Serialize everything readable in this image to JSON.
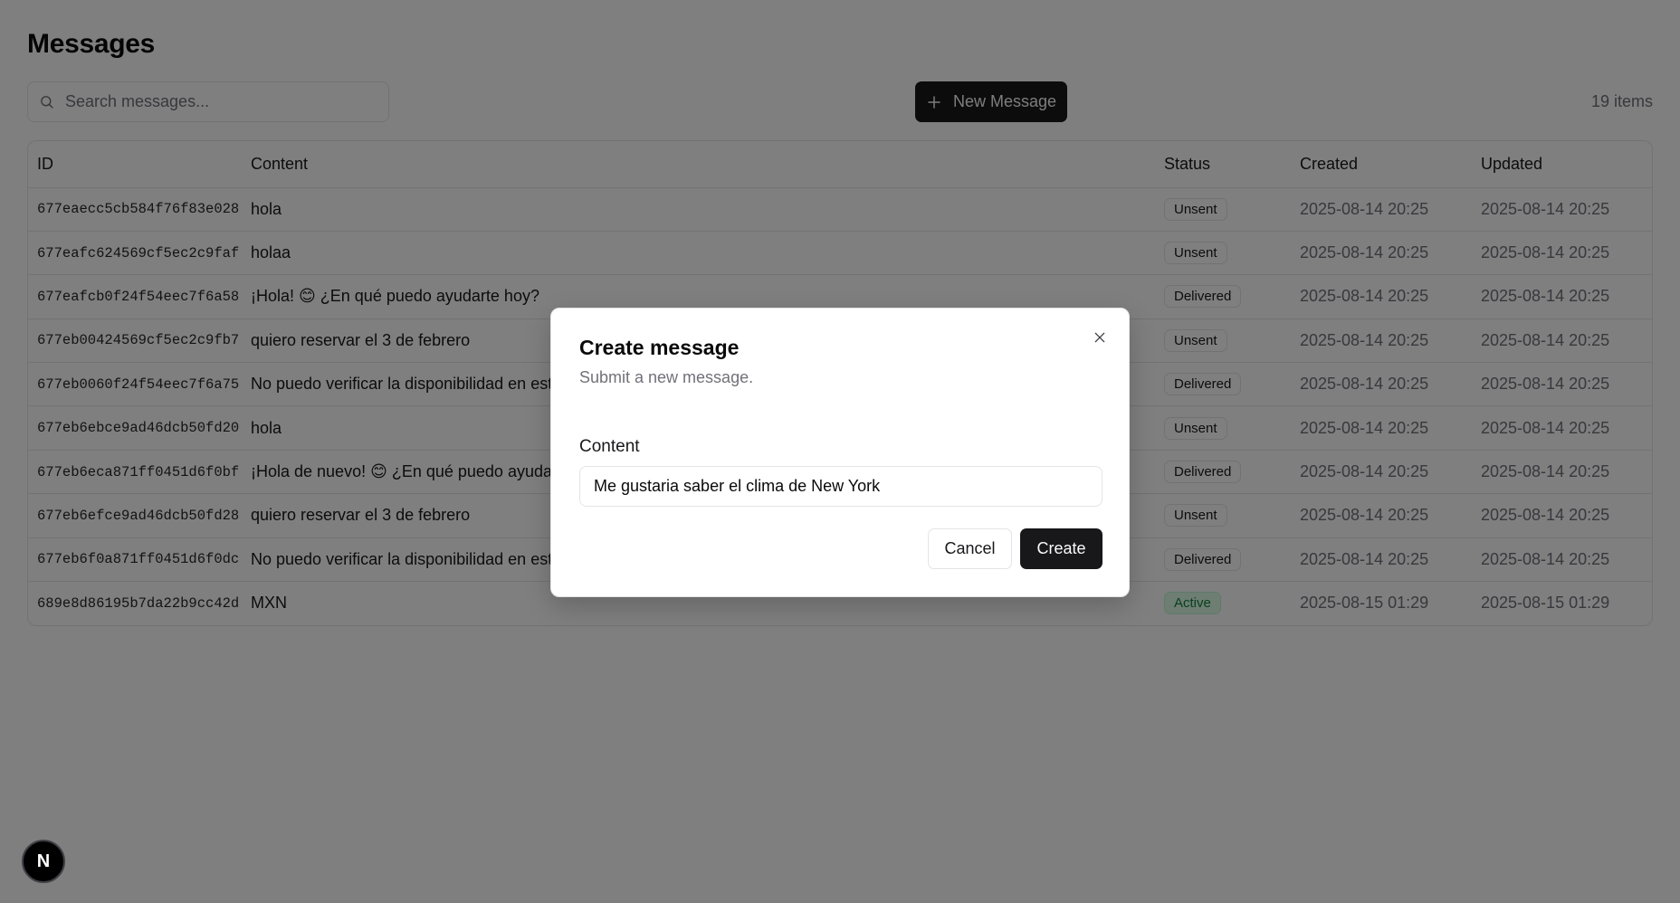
{
  "page": {
    "title": "Messages"
  },
  "toolbar": {
    "search_placeholder": "Search messages...",
    "new_button_label": "New Message",
    "item_count": "19 items"
  },
  "table": {
    "headers": [
      "ID",
      "Content",
      "Status",
      "Created",
      "Updated"
    ],
    "rows": [
      {
        "id": "677eaecc5cb584f76f83e028",
        "content": "hola",
        "status": "Unsent",
        "created": "2025-08-14 20:25",
        "updated": "2025-08-14 20:25"
      },
      {
        "id": "677eafc624569cf5ec2c9faf",
        "content": "holaa",
        "status": "Unsent",
        "created": "2025-08-14 20:25",
        "updated": "2025-08-14 20:25"
      },
      {
        "id": "677eafcb0f24f54eec7f6a58",
        "content": "¡Hola! 😊 ¿En qué puedo ayudarte hoy?",
        "status": "Delivered",
        "created": "2025-08-14 20:25",
        "updated": "2025-08-14 20:25"
      },
      {
        "id": "677eb00424569cf5ec2c9fb7",
        "content": "quiero reservar el 3 de febrero",
        "status": "Unsent",
        "created": "2025-08-14 20:25",
        "updated": "2025-08-14 20:25"
      },
      {
        "id": "677eb0060f24f54eec7f6a75",
        "content": "No puedo verificar la disponibilidad en este",
        "status": "Delivered",
        "created": "2025-08-14 20:25",
        "updated": "2025-08-14 20:25"
      },
      {
        "id": "677eb6ebce9ad46dcb50fd20",
        "content": "hola",
        "status": "Unsent",
        "created": "2025-08-14 20:25",
        "updated": "2025-08-14 20:25"
      },
      {
        "id": "677eb6eca871ff0451d6f0bf",
        "content": "¡Hola de nuevo! 😊 ¿En qué puedo ayudart",
        "status": "Delivered",
        "created": "2025-08-14 20:25",
        "updated": "2025-08-14 20:25"
      },
      {
        "id": "677eb6efce9ad46dcb50fd28",
        "content": "quiero reservar el 3 de febrero",
        "status": "Unsent",
        "created": "2025-08-14 20:25",
        "updated": "2025-08-14 20:25"
      },
      {
        "id": "677eb6f0a871ff0451d6f0dc",
        "content": "No puedo verificar la disponibilidad en este",
        "status": "Delivered",
        "created": "2025-08-14 20:25",
        "updated": "2025-08-14 20:25"
      },
      {
        "id": "689e8d86195b7da22b9cc42d",
        "content": "MXN",
        "status": "Active",
        "created": "2025-08-15 01:29",
        "updated": "2025-08-15 01:29"
      }
    ]
  },
  "dialog": {
    "title": "Create message",
    "description": "Submit a new message.",
    "content_label": "Content",
    "content_value": "Me gustaria saber el clima de New York",
    "cancel_label": "Cancel",
    "create_label": "Create"
  },
  "dev_badge": {
    "letter": "N"
  }
}
